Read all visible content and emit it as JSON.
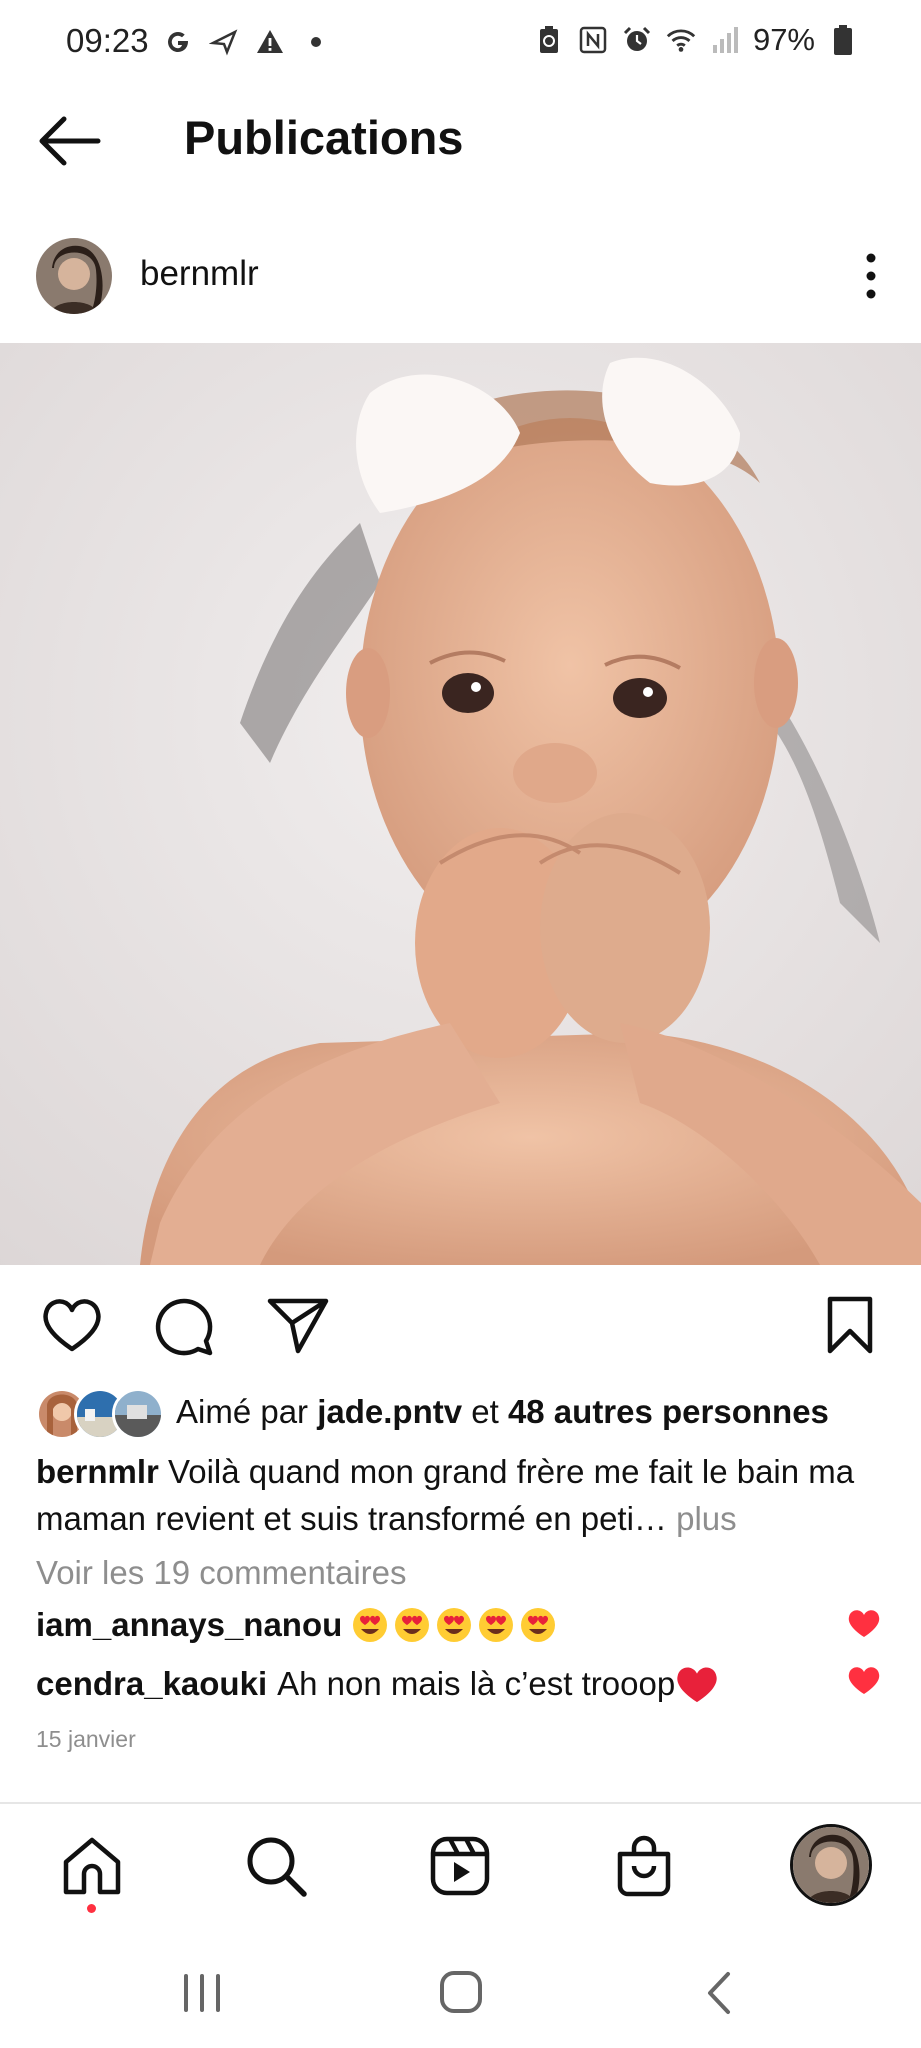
{
  "status_bar": {
    "time": "09:23",
    "battery": "97%",
    "left_icons": [
      "google-icon",
      "reply-arrow-icon",
      "warning-icon",
      "dot-icon"
    ],
    "right_icons": [
      "battery-saver-icon",
      "nfc-icon",
      "alarm-icon",
      "wifi-icon",
      "signal-icon",
      "battery-icon"
    ]
  },
  "header": {
    "title": "Publications"
  },
  "post": {
    "author": "bernmlr",
    "likes": {
      "prefix": "Aimé par ",
      "user": "jade.pntv",
      "middle": " et ",
      "others": "48 autres personnes"
    },
    "caption": {
      "author": "bernmlr",
      "text": " Voilà quand mon grand frère me fait le  bain ma maman revient et suis transformé en peti…",
      "more": " plus"
    },
    "view_comments": "Voir les 19 commentaires",
    "comments": [
      {
        "user": "iam_annays_nanou",
        "text": "",
        "emoji_count": 5
      },
      {
        "user": "cendra_kaouki",
        "text": "Ah non mais là c’est trooop"
      }
    ],
    "date": "15 janvier"
  },
  "bottom_nav": {
    "items": [
      "home-icon",
      "search-icon",
      "reels-icon",
      "shop-icon",
      "profile-avatar"
    ]
  },
  "colors": {
    "like_red": "#ff3040",
    "secondary_text": "#8e8e8e"
  }
}
